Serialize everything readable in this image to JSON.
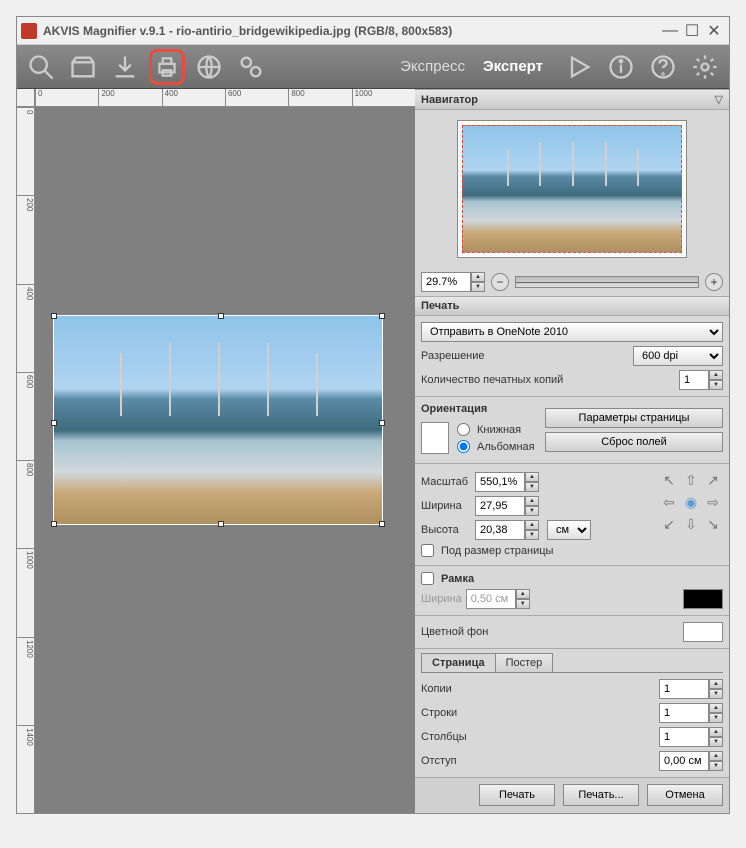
{
  "titlebar": {
    "title": "AKVIS Magnifier v.9.1 - rio-antirio_bridgewikipedia.jpg (RGB/8, 800x583)"
  },
  "toolbar": {
    "express": "Экспресс",
    "expert": "Эксперт"
  },
  "ruler_top": [
    "0",
    "200",
    "400",
    "600",
    "800",
    "1000"
  ],
  "ruler_left": [
    "0",
    "200",
    "400",
    "600",
    "800",
    "1000",
    "1200",
    "1400"
  ],
  "navigator": {
    "header": "Навигатор",
    "zoom": "29.7%"
  },
  "print": {
    "header": "Печать",
    "printer": "Отправить в OneNote 2010",
    "dpi_label": "Разрешение",
    "dpi": "600 dpi",
    "copies_label": "Количество печатных копий",
    "copies": "1",
    "orientation_header": "Ориентация",
    "portrait": "Книжная",
    "landscape": "Альбомная",
    "page_params": "Параметры страницы",
    "reset_margins": "Сброс полей",
    "scale_label": "Масштаб",
    "scale": "550,1%",
    "width_label": "Ширина",
    "width": "27,95",
    "height_label": "Высота",
    "height": "20,38",
    "unit": "см",
    "fit_page": "Под размер страницы",
    "frame_header": "Рамка",
    "frame_width_label": "Ширина",
    "frame_width": "0,50 см",
    "bg_label": "Цветной фон",
    "tab_page": "Страница",
    "tab_poster": "Постер",
    "t_copies_label": "Копии",
    "t_copies": "1",
    "t_rows_label": "Строки",
    "t_rows": "1",
    "t_cols_label": "Столбцы",
    "t_cols": "1",
    "t_margin_label": "Отступ",
    "t_margin": "0,00 см"
  },
  "footer": {
    "print": "Печать",
    "print_dlg": "Печать...",
    "cancel": "Отмена"
  }
}
